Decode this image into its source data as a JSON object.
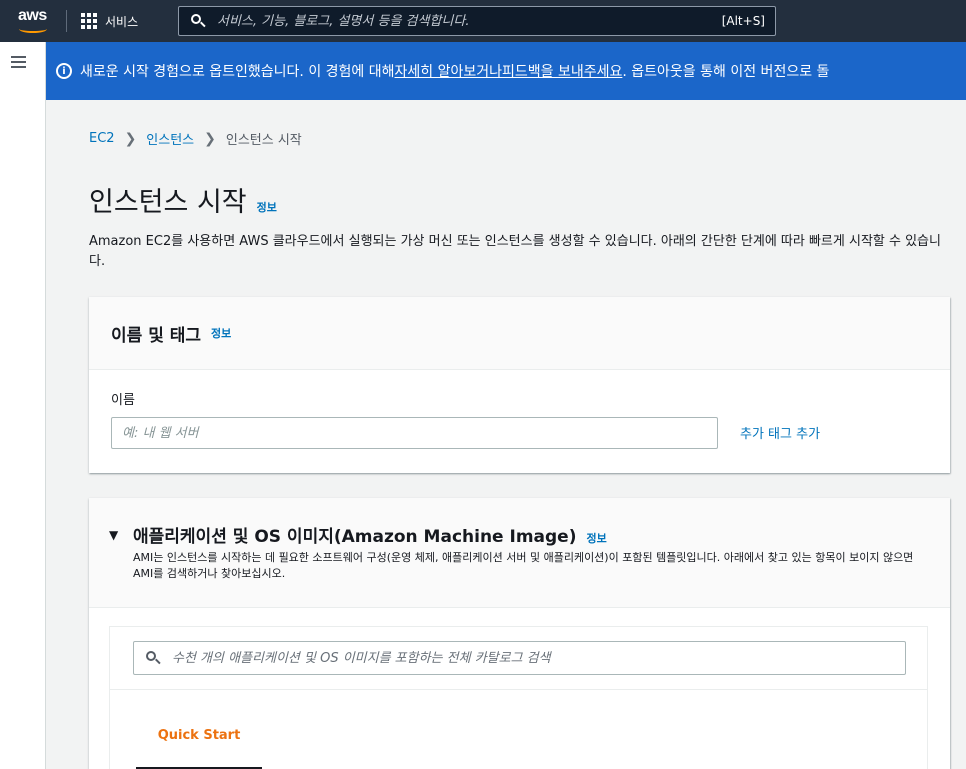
{
  "topnav": {
    "logo_text": "aws",
    "services_label": "서비스",
    "search_placeholder": "서비스, 기능, 블로그, 설명서 등을 검색합니다.",
    "search_shortcut": "[Alt+S]"
  },
  "flash": {
    "text_before": "새로운 시작 경험으로 옵트인했습니다. 이 경험에 대해 ",
    "link1": "자세히 알아보거나",
    "text_mid": " ",
    "link2": "피드백을 보내주세요",
    "text_after": ". 옵트아웃을 통해 이전 버전으로 돌"
  },
  "breadcrumb": {
    "items": [
      "EC2",
      "인스턴스",
      "인스턴스 시작"
    ]
  },
  "page": {
    "title": "인스턴스 시작",
    "info": "정보",
    "description": "Amazon EC2를 사용하면 AWS 클라우드에서 실행되는 가상 머신 또는 인스턴스를 생성할 수 있습니다. 아래의 간단한 단계에 따라 빠르게 시작할 수 있습니다."
  },
  "name_tags": {
    "title": "이름 및 태그",
    "info": "정보",
    "field_label": "이름",
    "input_placeholder": "예: 내 웹 서버",
    "add_tag": "추가 태그 추가"
  },
  "ami": {
    "toggle": "▼",
    "title": "애플리케이션 및 OS 이미지(Amazon Machine Image)",
    "info": "정보",
    "description": "AMI는 인스턴스를 시작하는 데 필요한 소프트웨어 구성(운영 체제, 애플리케이션 서버 및 애플리케이션)이 포함된 템플릿입니다. 아래에서 찾고 있는 항목이 보이지 않으면 AMI를 검색하거나 찾아보십시오.",
    "search_placeholder": "수천 개의 애플리케이션 및 OS 이미지를 포함하는 전체 카탈로그 검색",
    "tabs": [
      {
        "label": "Quick Start",
        "active": true
      }
    ]
  },
  "colors": {
    "nav_bg": "#232f3e",
    "flash_bg": "#1b66c9",
    "link": "#0073bb",
    "accent_orange": "#ec7211",
    "aws_orange": "#ff9900"
  }
}
